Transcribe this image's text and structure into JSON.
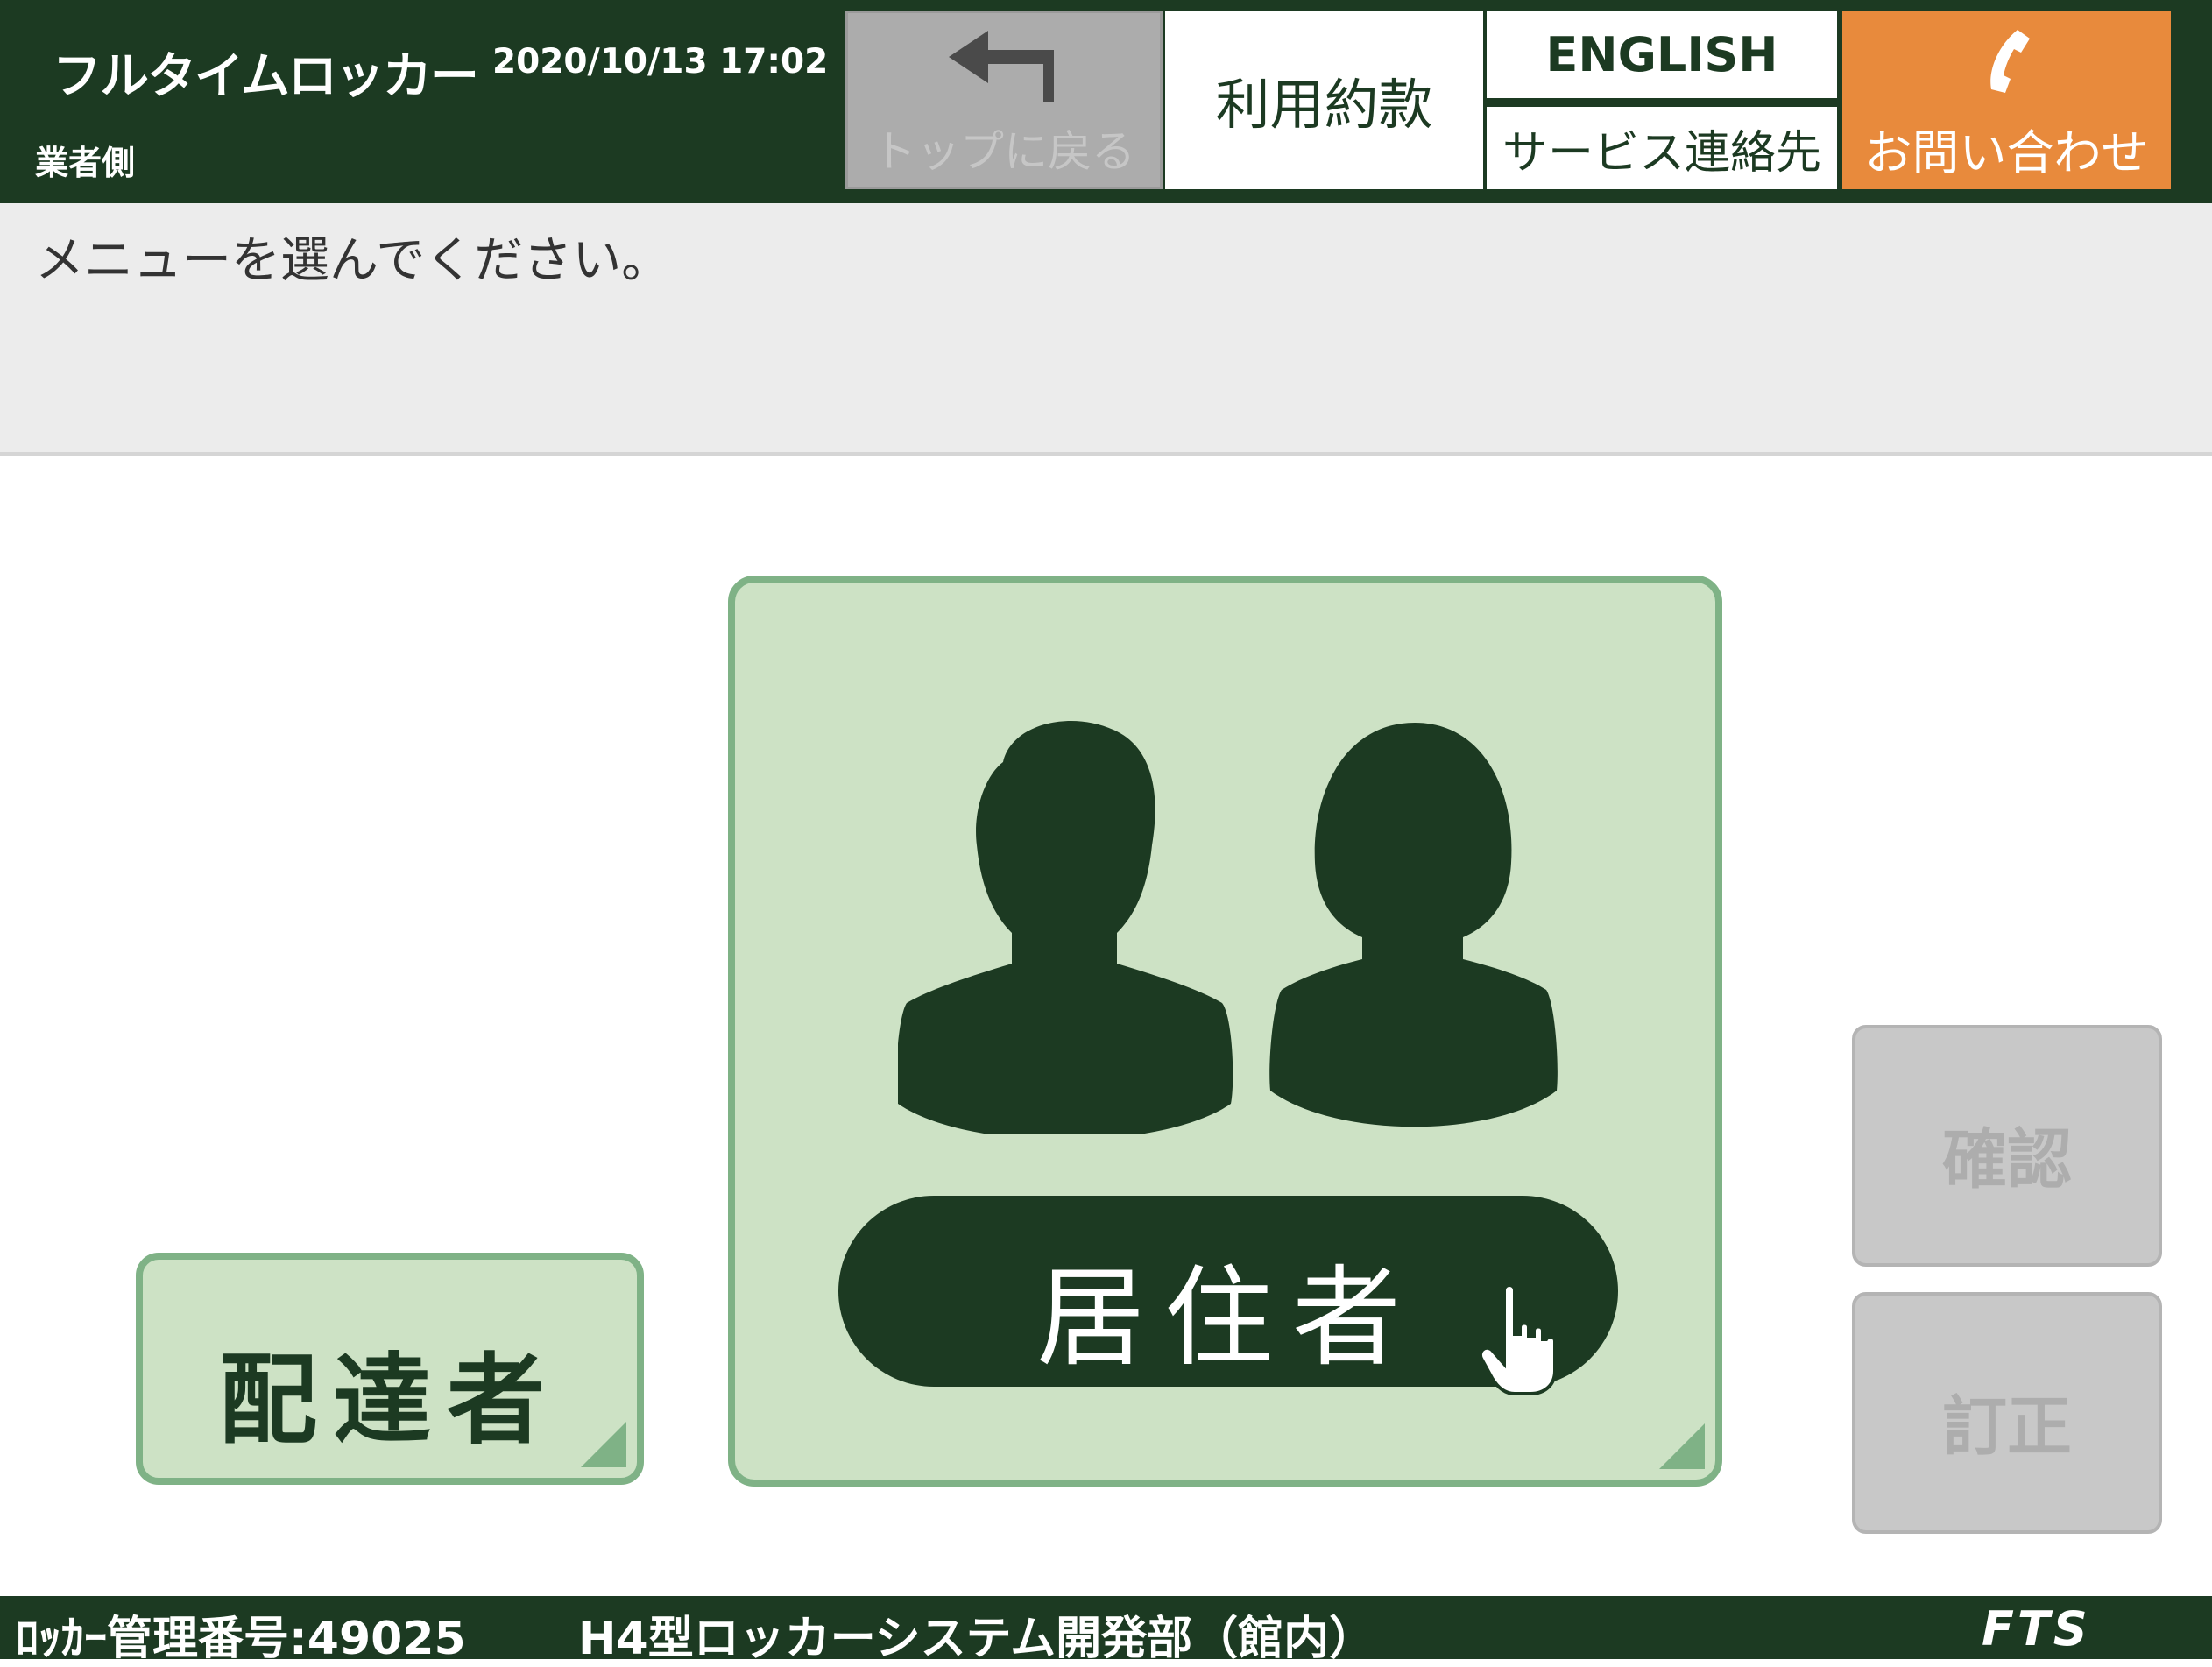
{
  "header": {
    "brand": "フルタイムロッカー",
    "datetime": "2020/10/13 17:02",
    "sub_label": "業者側",
    "back_label": "トップに戻る",
    "back_icon": "return-arrow-icon",
    "terms_label": "利用約款",
    "english_label": "ENGLISH",
    "service_label": "サービス連絡先",
    "contact_label": "お問い合わせ",
    "contact_icon": "phone-icon"
  },
  "message": "メニューを選んでください。",
  "main": {
    "delivery_label": "配達者",
    "resident_label": "居住者",
    "resident_icon": "people-icon",
    "pointer_icon": "hand-pointer-icon",
    "confirm_label": "確認",
    "correct_label": "訂正"
  },
  "footer": {
    "locker_id": "ﾛｯｶｰ管理番号:49025",
    "department": "H4型ロッカーシステム開発部（館内）",
    "logo": "FTS"
  },
  "colors": {
    "dark_green": "#1c3a22",
    "light_green": "#cde2c5",
    "border_green": "#7fb286",
    "orange": "#e88a3c",
    "disabled_gray": "#c8c8c8"
  }
}
